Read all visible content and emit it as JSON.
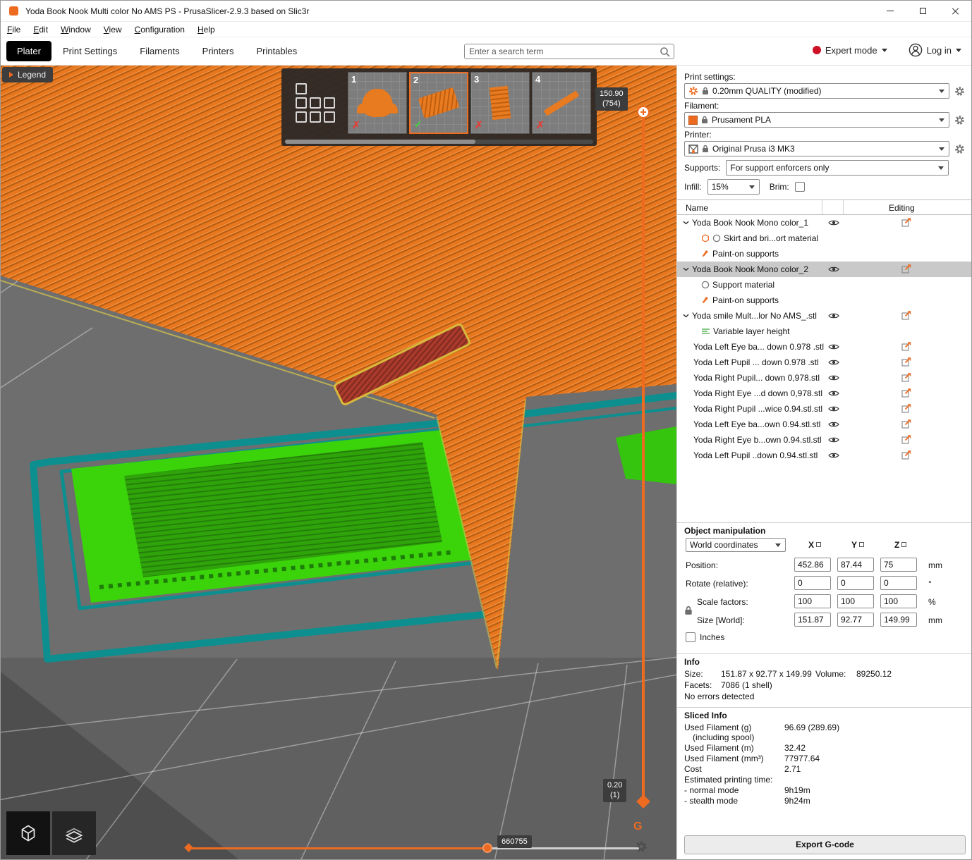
{
  "window": {
    "title": "Yoda Book Nook Multi color No AMS PS - PrusaSlicer-2.9.3 based on Slic3r"
  },
  "menu": {
    "items": [
      "File",
      "Edit",
      "Window",
      "View",
      "Configuration",
      "Help"
    ]
  },
  "tabs": {
    "plater": "Plater",
    "print_settings": "Print Settings",
    "filaments": "Filaments",
    "printers": "Printers",
    "printables": "Printables"
  },
  "topbar": {
    "search_placeholder": "Enter a search term",
    "expert_mode": "Expert mode",
    "login": "Log in"
  },
  "viewport": {
    "legend": "Legend",
    "thumbnails": [
      {
        "num": "1",
        "status_glyph": "✗"
      },
      {
        "num": "2",
        "status_glyph": "✓"
      },
      {
        "num": "3",
        "status_glyph": "✗"
      },
      {
        "num": "4",
        "status_glyph": "✗"
      }
    ],
    "layer_slider": {
      "top_value": "150.90",
      "top_count": "(754)",
      "bottom_value": "0.20",
      "bottom_count": "(1)",
      "gcode_label": "G"
    },
    "move_slider": {
      "value": "660755"
    }
  },
  "sidebar": {
    "print_settings": {
      "label": "Print settings:",
      "value": "0.20mm QUALITY (modified)"
    },
    "filament": {
      "label": "Filament:",
      "value": "Prusament PLA",
      "color": "#ED6B21"
    },
    "printer": {
      "label": "Printer:",
      "value": "Original Prusa i3 MK3"
    },
    "supports": {
      "label": "Supports:",
      "value": "For support enforcers only"
    },
    "infill": {
      "label": "Infill:",
      "value": "15%"
    },
    "brim": {
      "label": "Brim:"
    },
    "tree": {
      "name_col": "Name",
      "editing_col": "Editing",
      "rows": [
        {
          "label": "Yoda Book Nook Mono color_1",
          "type": "object",
          "chevron": true,
          "eye": true,
          "edit": true
        },
        {
          "label": "Skirt and bri...ort material",
          "type": "sub",
          "icons": [
            "brim",
            "circle"
          ]
        },
        {
          "label": "Paint-on supports",
          "type": "sub",
          "icons": [
            "paint"
          ]
        },
        {
          "label": "Yoda Book Nook Mono color_2",
          "type": "object",
          "chevron": true,
          "eye": true,
          "edit": true,
          "selected": true
        },
        {
          "label": "Support material",
          "type": "sub",
          "icons": [
            "circle"
          ]
        },
        {
          "label": "Paint-on supports",
          "type": "sub",
          "icons": [
            "paint"
          ]
        },
        {
          "label": "Yoda smile Mult...lor No AMS_.stl",
          "type": "object",
          "chevron": true,
          "eye": true,
          "edit": true
        },
        {
          "label": "Variable layer height",
          "type": "sub",
          "icons": [
            "layers"
          ]
        },
        {
          "label": "Yoda Left Eye ba... down 0.978 .stl",
          "type": "part",
          "eye": true,
          "edit": true
        },
        {
          "label": "Yoda Left Pupil ... down 0.978 .stl",
          "type": "part",
          "eye": true,
          "edit": true
        },
        {
          "label": "Yoda Right Pupil... down 0,978.stl",
          "type": "part",
          "eye": true,
          "edit": true
        },
        {
          "label": "Yoda Right Eye ...d down 0,978.stl",
          "type": "part",
          "eye": true,
          "edit": true
        },
        {
          "label": "Yoda Right Pupil ...wice 0.94.stl.stl",
          "type": "part",
          "eye": true,
          "edit": true
        },
        {
          "label": "Yoda Left Eye ba...own 0.94.stl.stl",
          "type": "part",
          "eye": true,
          "edit": true
        },
        {
          "label": "Yoda Right Eye b...own 0.94.stl.stl",
          "type": "part",
          "eye": true,
          "edit": true
        },
        {
          "label": "Yoda Left Pupil ..down 0.94.stl.stl",
          "type": "part",
          "eye": true,
          "edit": true
        }
      ]
    },
    "manip": {
      "title": "Object manipulation",
      "coords_value": "World coordinates",
      "axes": [
        "X",
        "Y",
        "Z"
      ],
      "rows": [
        {
          "label": "Position:",
          "values": [
            "452.86",
            "87.44",
            "75"
          ],
          "unit": "mm"
        },
        {
          "label": "Rotate (relative):",
          "values": [
            "0",
            "0",
            "0"
          ],
          "unit": "°"
        },
        {
          "label": "Scale factors:",
          "values": [
            "100",
            "100",
            "100"
          ],
          "unit": "%"
        },
        {
          "label": "Size [World]:",
          "values": [
            "151.87",
            "92.77",
            "149.99"
          ],
          "unit": "mm"
        }
      ],
      "inches_label": "Inches"
    },
    "info": {
      "title": "Info",
      "size_label": "Size:",
      "size_value": "151.87 x 92.77 x 149.99",
      "volume_label": "Volume:",
      "volume_value": "89250.12",
      "facets_label": "Facets:",
      "facets_value": "7086 (1 shell)",
      "errors": "No errors detected"
    },
    "sliced": {
      "title": "Sliced Info",
      "rows": [
        {
          "label": "Used Filament (g)",
          "sub": "(including spool)",
          "value": "96.69 (289.69)"
        },
        {
          "label": "Used Filament (m)",
          "value": "32.42"
        },
        {
          "label": "Used Filament (mm³)",
          "value": "77977.64"
        },
        {
          "label": "Cost",
          "value": "2.71"
        },
        {
          "label": "Estimated printing time:",
          "value": ""
        },
        {
          "label": "- normal mode",
          "value": "9h19m"
        },
        {
          "label": "- stealth mode",
          "value": "9h24m"
        }
      ]
    },
    "export_button": "Export G-code"
  },
  "colors": {
    "accent": "#ED6B21",
    "model_orange": "#E8781F",
    "green": "#3BD30A",
    "teal": "#0D8F8F",
    "expert_red": "#CE1126",
    "selected_row": "#C9C9C9"
  }
}
